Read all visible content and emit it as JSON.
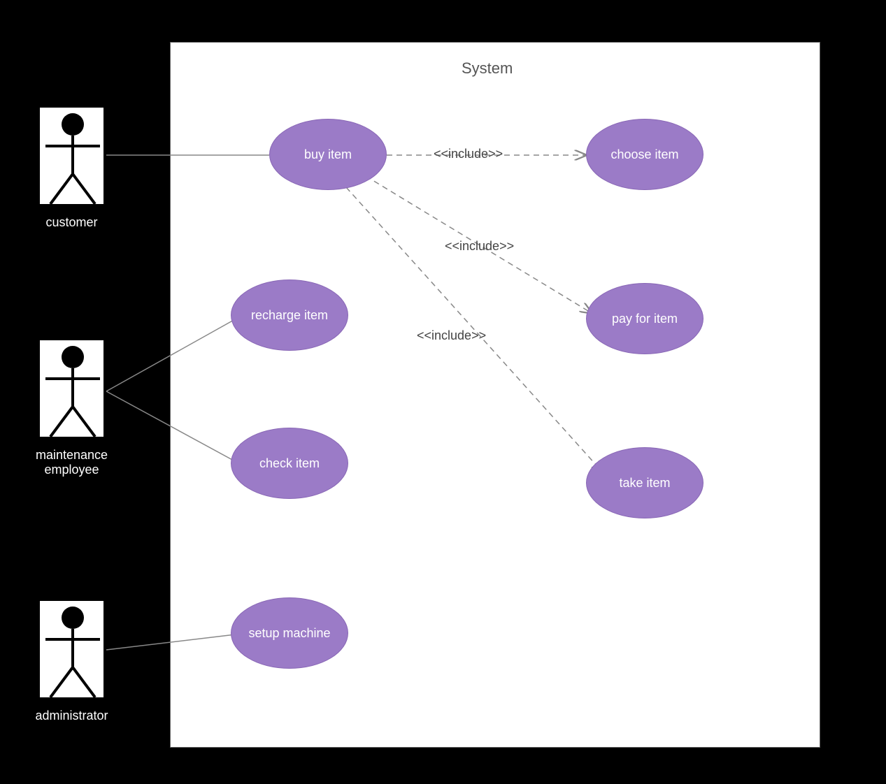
{
  "diagram": {
    "title": "System",
    "actors": [
      {
        "id": "customer",
        "label": "customer"
      },
      {
        "id": "maintenance",
        "label": "maintenance employee"
      },
      {
        "id": "administrator",
        "label": "administrator"
      }
    ],
    "usecases": [
      {
        "id": "buy",
        "label": "buy item"
      },
      {
        "id": "recharge",
        "label": "recharge item"
      },
      {
        "id": "check",
        "label": "check item"
      },
      {
        "id": "setup",
        "label": "setup machine"
      },
      {
        "id": "choose",
        "label": "choose item"
      },
      {
        "id": "pay",
        "label": "pay for item"
      },
      {
        "id": "take",
        "label": "take item"
      }
    ],
    "relationships": {
      "include1": "<<include>>",
      "include2": "<<include>>",
      "include3": "<<include>>"
    },
    "associations": [
      {
        "from": "customer",
        "to": "buy",
        "type": "solid"
      },
      {
        "from": "maintenance",
        "to": "recharge",
        "type": "solid"
      },
      {
        "from": "maintenance",
        "to": "check",
        "type": "solid"
      },
      {
        "from": "administrator",
        "to": "setup",
        "type": "solid"
      },
      {
        "from": "buy",
        "to": "choose",
        "type": "include"
      },
      {
        "from": "buy",
        "to": "pay",
        "type": "include"
      },
      {
        "from": "buy",
        "to": "take",
        "type": "include"
      }
    ]
  }
}
